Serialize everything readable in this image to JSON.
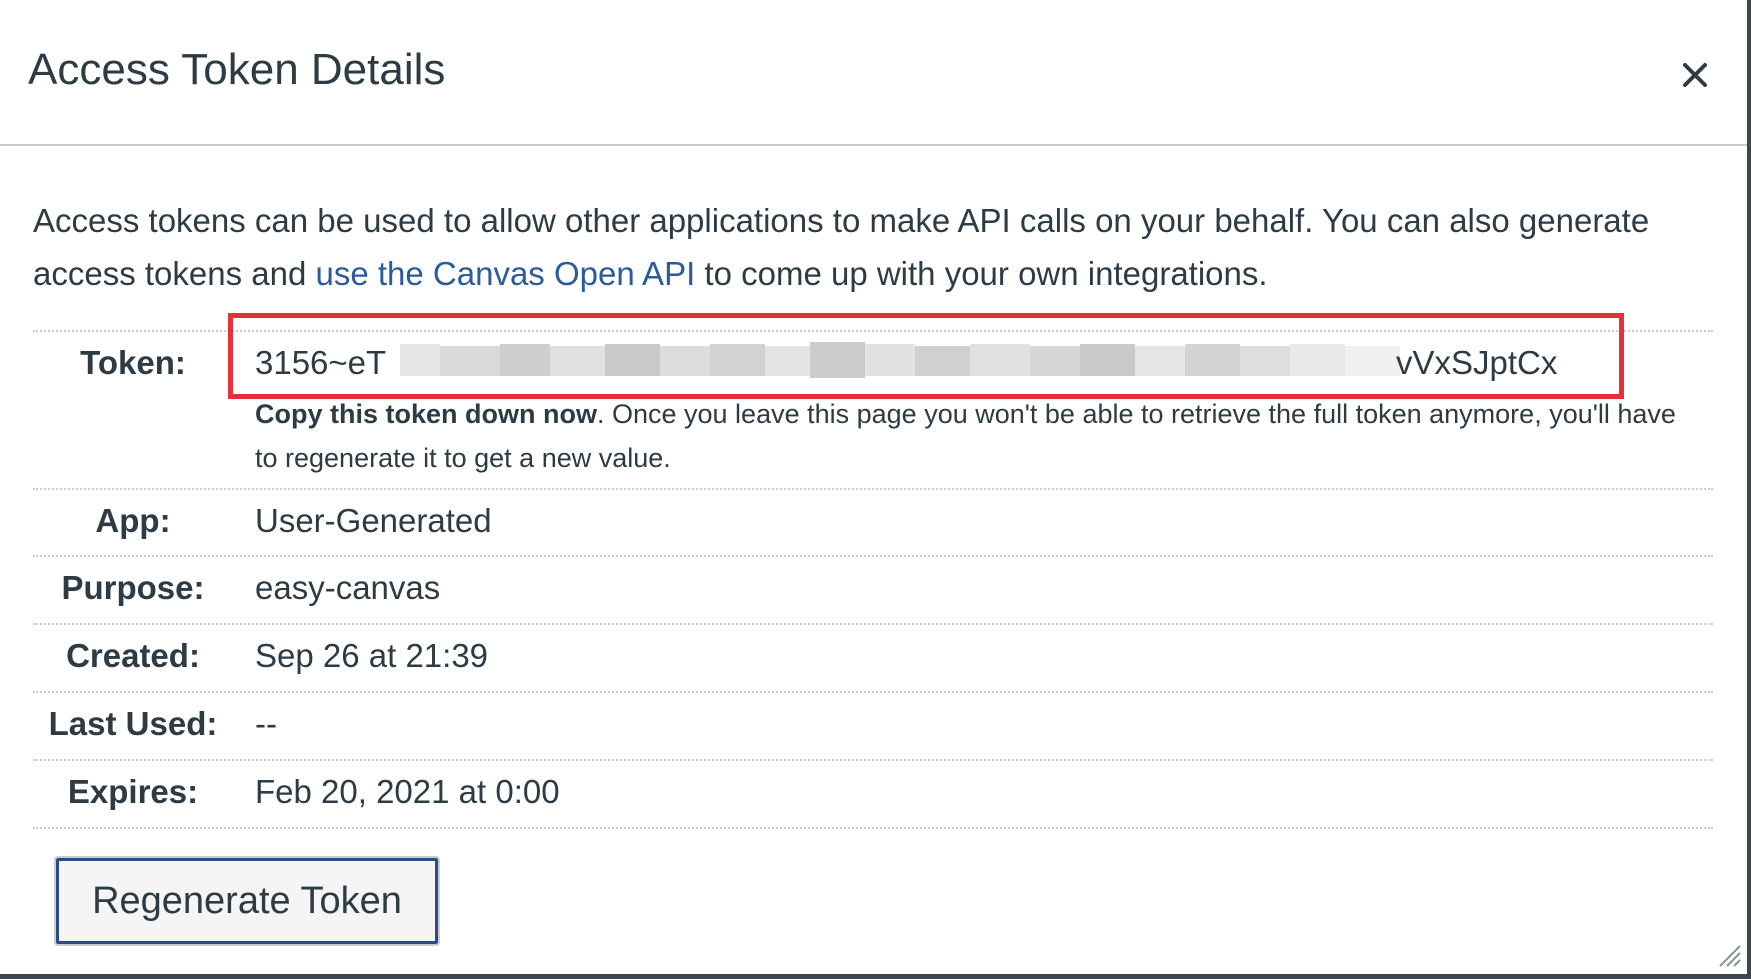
{
  "dialog": {
    "title": "Access Token Details",
    "close_icon": "close-icon",
    "intro_before_link": "Access tokens can be used to allow other applications to make API calls on your behalf. You can also generate access tokens and ",
    "intro_link": "use the Canvas Open API",
    "intro_after_link": " to come up with your own integrations."
  },
  "token": {
    "label": "Token:",
    "prefix": "3156~eT",
    "suffix": "vVxSJptCx",
    "warning_bold": "Copy this token down now",
    "warning_rest": ". Once you leave this page you won't be able to retrieve the full token anymore, you'll have to regenerate it to get a new value."
  },
  "details": [
    {
      "label": "App:",
      "value": "User-Generated"
    },
    {
      "label": "Purpose:",
      "value": "easy-canvas"
    },
    {
      "label": "Created:",
      "value": "Sep 26 at 21:39"
    },
    {
      "label": "Last Used:",
      "value": "--"
    },
    {
      "label": "Expires:",
      "value": "Feb 20, 2021 at 0:00"
    }
  ],
  "actions": {
    "regenerate_label": "Regenerate Token"
  },
  "colors": {
    "text": "#2d3b45",
    "link": "#2b5b9b",
    "highlight_border": "#e6313a",
    "button_focus": "#2b4a8b"
  }
}
